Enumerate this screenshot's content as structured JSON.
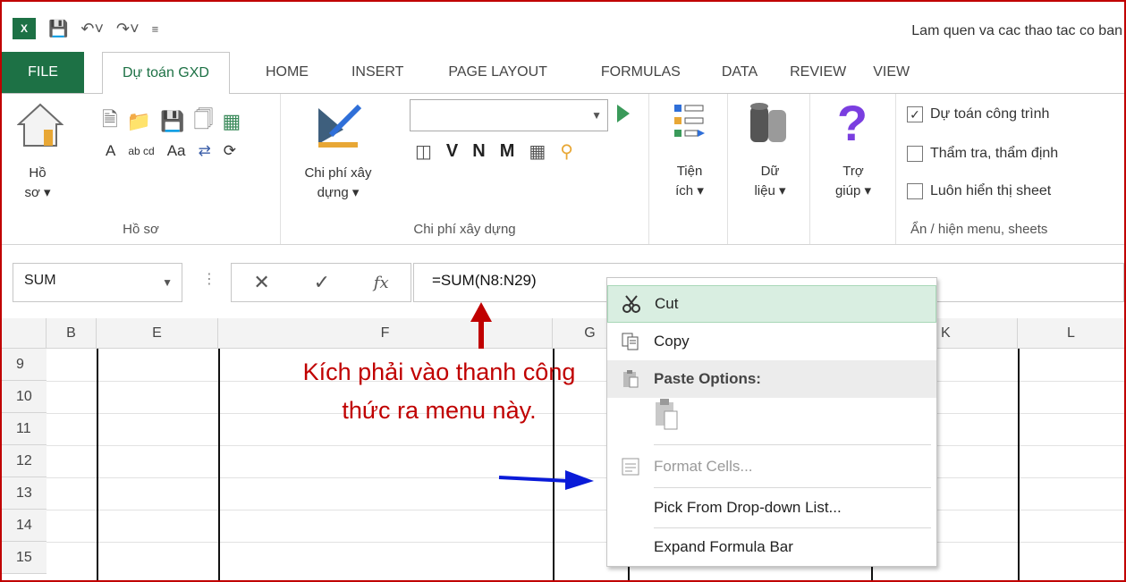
{
  "window": {
    "title": "Lam quen va cac thao tac co ban"
  },
  "tabs": [
    "FILE",
    "Dự toán GXD",
    "HOME",
    "INSERT",
    "PAGE LAYOUT",
    "FORMULAS",
    "DATA",
    "REVIEW",
    "VIEW"
  ],
  "ribbon": {
    "hoso": {
      "button": "Hồ\nsơ ▾",
      "caption": "Hồ sơ",
      "small_icons": [
        "A",
        "ab cd",
        "Aa"
      ]
    },
    "chiphi": {
      "button": "Chi phí xây\ndựng ▾",
      "caption": "Chi phí xây dựng",
      "letters": [
        "V",
        "N",
        "M"
      ]
    },
    "tienich": {
      "label": "Tiện\ních ▾"
    },
    "dulieu": {
      "label": "Dữ\nliệu ▾"
    },
    "trogiup": {
      "label": "Trợ\ngiúp ▾"
    },
    "anhien": {
      "caption": "Ẩn / hiện menu, sheets",
      "checkboxes": [
        {
          "label": "Dự toán công trình",
          "checked": true
        },
        {
          "label": "Thẩm tra, thẩm định",
          "checked": false
        },
        {
          "label": "Luôn hiển thị sheet",
          "checked": false
        }
      ]
    }
  },
  "formula_bar": {
    "name_box": "SUM",
    "formula": "=SUM(N8:N29)"
  },
  "grid": {
    "columns": [
      "B",
      "E",
      "F",
      "G",
      "K",
      "L"
    ],
    "rows": [
      "9",
      "10",
      "11",
      "12",
      "13",
      "14",
      "15"
    ]
  },
  "annotation": {
    "text": "Kích phải vào thanh công thức ra menu này.",
    "color": "#c00000"
  },
  "context_menu": {
    "items": [
      {
        "label": "Cut",
        "icon": "scissors-icon",
        "state": "highlighted"
      },
      {
        "label": "Copy",
        "icon": "copy-icon",
        "state": "normal"
      },
      {
        "label": "Paste Options:",
        "icon": "paste-icon",
        "state": "header"
      },
      {
        "label": "Format Cells...",
        "icon": "format-cells-icon",
        "state": "disabled"
      },
      {
        "label": "Pick From Drop-down List...",
        "icon": "",
        "state": "normal"
      },
      {
        "label": "Expand Formula Bar",
        "icon": "",
        "state": "normal"
      }
    ]
  },
  "colors": {
    "excel_green": "#1d7145",
    "highlight": "#d9eee1",
    "annotation_red": "#c00000",
    "arrow_blue": "#0a1bd8"
  }
}
